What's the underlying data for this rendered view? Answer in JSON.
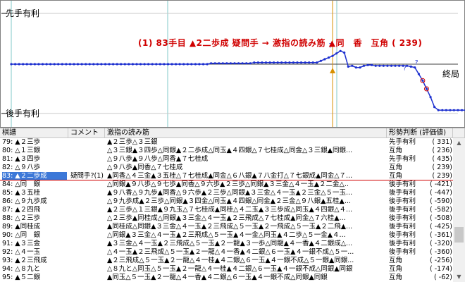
{
  "graph": {
    "label_top": "先手有利",
    "label_bottom": "後手有利",
    "label_end": "終局",
    "annotation": "(1) 83手目 ▲2二歩成 疑問手 → 激指の読み筋 ▲同　香　互角 ( 239)",
    "colors": {
      "line": "#1c2fcf",
      "marker": "#d00000",
      "cursor": "#d89000"
    }
  },
  "table": {
    "headers": [
      "棋譜",
      "コメント",
      "激指の読み筋",
      "形勢判断 (評価値)"
    ],
    "rows": [
      {
        "move": "79: ▲２三歩",
        "comment": "",
        "pv": "▲２三歩△３三銀",
        "judge": "先手有利",
        "score": "( 331)"
      },
      {
        "move": "80: △１三銀",
        "comment": "",
        "pv": "△３三銀▲３四歩△同銀▲２二歩成△同玉▲４四銀△７七桂成△同金△３三銀▲同銀...",
        "judge": "互角",
        "score": "( 236)"
      },
      {
        "move": "81: ▲３四歩",
        "comment": "",
        "pv": "△９八歩▲９八歩△同香▲７七桂成",
        "judge": "先手有利",
        "score": "( 435)"
      },
      {
        "move": "82: △９八歩",
        "comment": "",
        "pv": "△９八歩▲同香△７七桂成",
        "judge": "互角",
        "score": "( 239)"
      },
      {
        "move": "83: ▲２二歩成",
        "comment": "疑問手?(1)",
        "pv": "▲同香△４三金▲３五桂△７七桂成▲同金△６八銀▲７八金打△７七銀成▲同金△７...",
        "judge": "互角",
        "score": "( 239)",
        "selected": true
      },
      {
        "move": "84: △同　銀",
        "comment": "",
        "pv": "△同銀▲９八歩△９七歩▲同香△９六歩▲２三歩△同銀▲３三金△４一玉▲２二金△..",
        "judge": "後手有利",
        "score": "( -421)"
      },
      {
        "move": "85: ▲３五桂",
        "comment": "",
        "pv": "▲９八香△９九歩▲同香△９六歩▲２三歩△同銀▲３三金△４一玉▲２三金△５一玉...",
        "judge": "後手有利",
        "score": "( -447)"
      },
      {
        "move": "86: △９九歩成",
        "comment": "",
        "pv": "△９九歩成▲２三歩△同銀▲３四金△同玉▲４四銀△同金▲２三金△９八銀▲五桂▲...",
        "judge": "後手有利",
        "score": "( -590)"
      },
      {
        "move": "87: ▲２四飛",
        "comment": "",
        "pv": "▲２三歩△１三銀▲９九玉△７七桂成▲同桂△４二玉▲３三歩成△同玉▲４四銀△４...",
        "judge": "後手有利",
        "score": "( -582)"
      },
      {
        "move": "88: △２三歩",
        "comment": "",
        "pv": "△２三歩▲同桂成△同銀▲３三金△４一玉▲２三飛成△７七桂成▲同金△７六桂▲...",
        "judge": "後手有利",
        "score": "( -508)"
      },
      {
        "move": "89: ▲同桂成",
        "comment": "",
        "pv": "▲同桂成△同銀▲３三金△４一玉▲２三飛成△５一玉▲２一飛成△５一玉▲２二飛▲...",
        "judge": "後手有利",
        "score": "( -425)"
      },
      {
        "move": "90: △同　銀",
        "comment": "",
        "pv": "△同銀▲３三金△４一玉▲２三飛成△５一玉▲４一金△同玉▲４二歩△５一金▲４...",
        "judge": "後手有利",
        "score": "( -361)"
      },
      {
        "move": "91: ▲３三金",
        "comment": "",
        "pv": "▲３三金△４一玉▲２三飛成△５一玉▲２一龍▲３一歩△同龍▲４一香▲４二銀成△...",
        "judge": "後手有利",
        "score": "( -320)"
      },
      {
        "move": "92: △４一玉",
        "comment": "",
        "pv": "△４一玉▲２三飛成△５一玉▲２一龍△４一香▲４二銀△６一玉▲４一銀不成△５一...",
        "judge": "後手有利",
        "score": "( -360)"
      },
      {
        "move": "93: ▲２三飛成",
        "comment": "",
        "pv": "▲２三飛成△５一玉▲２一龍△４一桂▲４二銀△６一玉▲４一銀不成△５一銀▲同銀...",
        "judge": "互角",
        "score": "( -256)"
      },
      {
        "move": "94: △８九と",
        "comment": "",
        "pv": "△８九と△同玉△５一玉▲２一龍△４一桂▲４二銀△６一玉▲４一銀不成△同銀▲同銀",
        "judge": "互角",
        "score": "( -174)"
      },
      {
        "move": "95: ▲５二銀",
        "comment": "",
        "pv": "▲同玉△５一玉▲２一龍△４一香▲４二銀△６一玉▲４一銀不成△同銀▲同銀",
        "judge": "互角",
        "score": "( -62)"
      }
    ]
  },
  "chart_data": {
    "type": "line",
    "x_range": [
      1,
      115
    ],
    "y_range": [
      -600,
      600
    ],
    "marked_move": 83,
    "series": [
      {
        "values": [
          0,
          0,
          0,
          0,
          0,
          0,
          0,
          0,
          0,
          0,
          0,
          0,
          0,
          0,
          0,
          0,
          0,
          0,
          0,
          0,
          0,
          0,
          0,
          0,
          0,
          0,
          0,
          0,
          0,
          0,
          0,
          0,
          0,
          0,
          0,
          0,
          0,
          0,
          0,
          0,
          0,
          0,
          0,
          0,
          0,
          0,
          0,
          0,
          0,
          0,
          0,
          10,
          10,
          10,
          10,
          10,
          10,
          10,
          10,
          10,
          10,
          10,
          20,
          20,
          20,
          20,
          20,
          20,
          20,
          20,
          20,
          20,
          20,
          20,
          20,
          20,
          20,
          20,
          20,
          40,
          60,
          80,
          100,
          130,
          160,
          140,
          -30,
          -20,
          -40,
          -40,
          -20,
          -10,
          -10,
          -20,
          -20,
          -20,
          -20,
          -20,
          -20,
          -20,
          -20,
          -20,
          -30,
          -40,
          -120,
          -200,
          -300,
          -400,
          -520,
          -560,
          -560,
          -560,
          -560,
          -560,
          -560,
          -560,
          -560
        ]
      }
    ]
  }
}
